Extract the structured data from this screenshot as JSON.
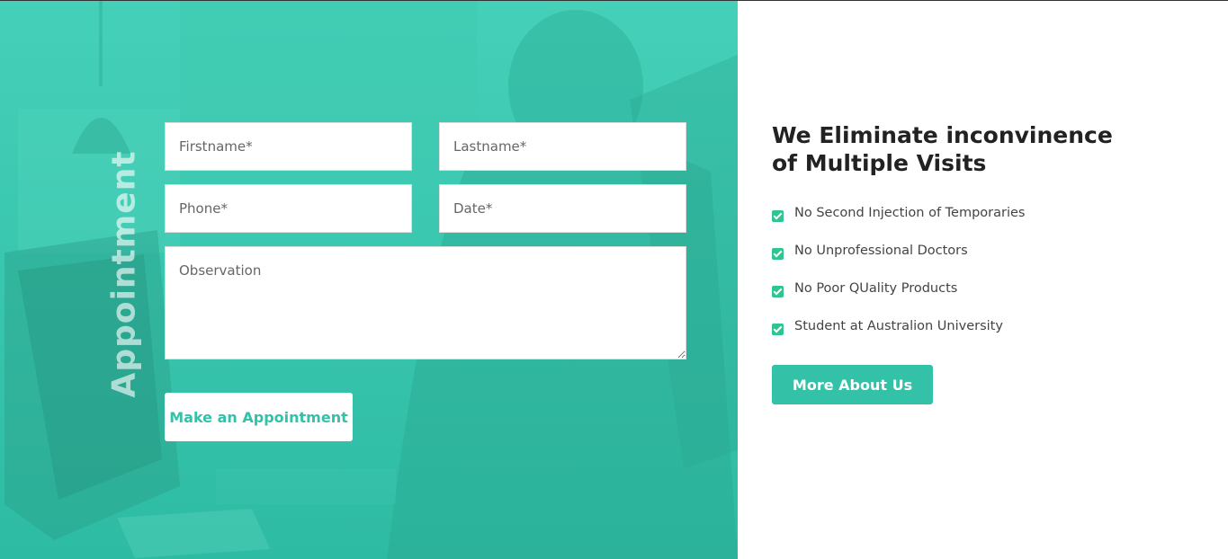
{
  "appointment": {
    "heading": "Appointment",
    "fields": {
      "firstname_placeholder": "Firstname*",
      "lastname_placeholder": "Lastname*",
      "phone_placeholder": "Phone*",
      "date_placeholder": "Date*",
      "observation_placeholder": "Observation"
    },
    "submit_label": "Make an Appointment"
  },
  "info": {
    "title": "We Eliminate inconvinence of Multiple Visits",
    "features": [
      {
        "label": "No Second Injection of Temporaries",
        "icon": "check-square-icon"
      },
      {
        "label": "No Unprofessional Doctors",
        "icon": "check-square-icon"
      },
      {
        "label": "No Poor QUality Products",
        "icon": "check-square-icon"
      },
      {
        "label": "Student at Australion University",
        "icon": "check-square-icon"
      }
    ],
    "more_label": "More About Us"
  },
  "colors": {
    "accent": "#33c1a8",
    "check": "#2ec58f",
    "title": "#222222",
    "text": "#444444"
  }
}
